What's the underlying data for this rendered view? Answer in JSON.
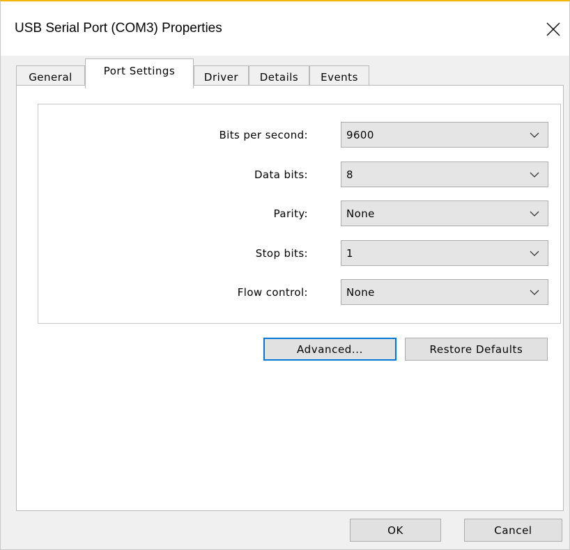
{
  "window": {
    "title": "USB Serial Port (COM3) Properties",
    "close_icon": "close-icon"
  },
  "tabs": [
    {
      "label": "General",
      "active": false
    },
    {
      "label": "Port Settings",
      "active": true
    },
    {
      "label": "Driver",
      "active": false
    },
    {
      "label": "Details",
      "active": false
    },
    {
      "label": "Events",
      "active": false
    }
  ],
  "settings": [
    {
      "label": "Bits per second:",
      "value": "9600"
    },
    {
      "label": "Data bits:",
      "value": "8"
    },
    {
      "label": "Parity:",
      "value": "None"
    },
    {
      "label": "Stop bits:",
      "value": "1"
    },
    {
      "label": "Flow control:",
      "value": "None"
    }
  ],
  "buttons": {
    "advanced": "Advanced...",
    "restore_defaults": "Restore Defaults",
    "ok": "OK",
    "cancel": "Cancel"
  },
  "colors": {
    "focus": "#0078d7",
    "window_accent": "#f2b600"
  }
}
